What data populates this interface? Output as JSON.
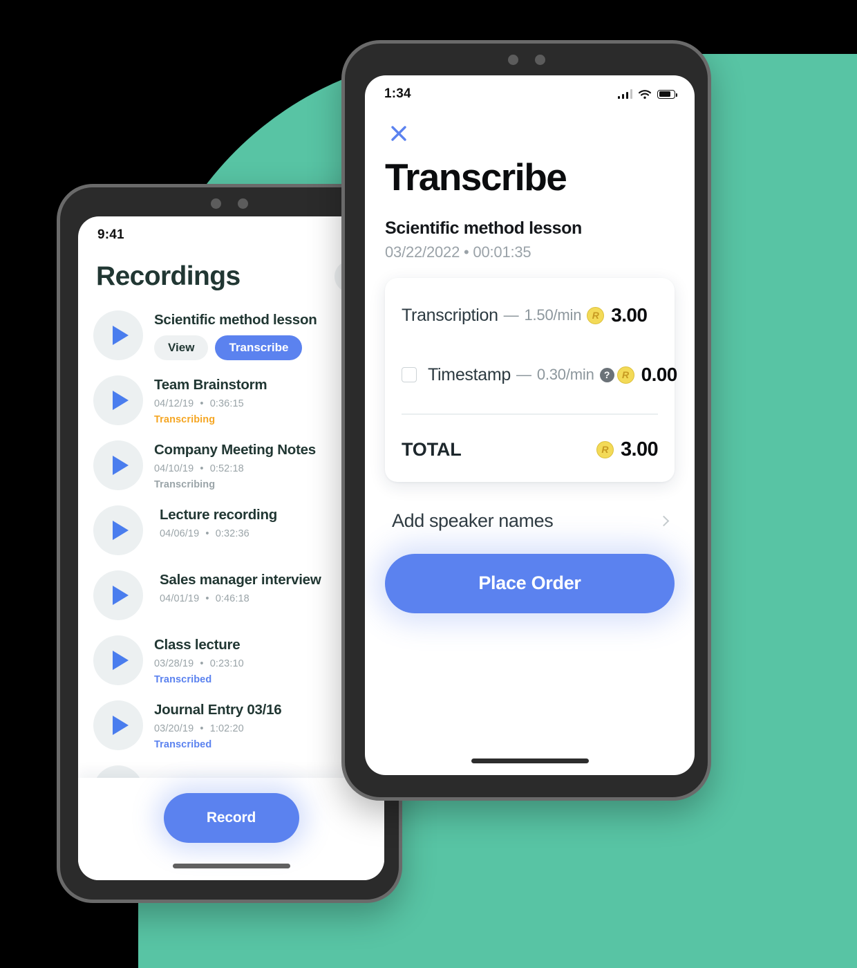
{
  "theme": {
    "accent_blue": "#5b82ef",
    "backdrop_green": "#58C4A4",
    "heading_dark": "#213733",
    "coin_yellow": "#f3da57",
    "status_transcribing": "#f5a623",
    "status_transcribed": "#5b82ef",
    "muted_gray": "#9aa4a8"
  },
  "recordings_phone": {
    "status_bar": {
      "time": "9:41",
      "signal_icon": "cellular-signal-icon"
    },
    "header": {
      "title": "Recordings",
      "search_icon": "search-icon"
    },
    "items": [
      {
        "name": "Scientific method lesson",
        "play_icon": "play-icon",
        "actions": [
          {
            "label": "View",
            "style": "secondary"
          },
          {
            "label": "Transcribe",
            "style": "primary"
          }
        ]
      },
      {
        "name": "Team Brainstorm",
        "play_icon": "play-icon",
        "date": "04/12/19",
        "separator": "•",
        "duration": "0:36:15",
        "status": "Transcribing",
        "status_style": "transcribing-active"
      },
      {
        "name": "Company Meeting Notes",
        "play_icon": "play-icon",
        "date": "04/10/19",
        "separator": "•",
        "duration": "0:52:18",
        "status": "Transcribing",
        "status_style": "transcribing-idle"
      },
      {
        "name": "Lecture recording",
        "play_icon": "play-icon",
        "date": "04/06/19",
        "separator": "•",
        "duration": "0:32:36",
        "status": "",
        "status_style": "none"
      },
      {
        "name": "Sales manager interview",
        "play_icon": "play-icon",
        "date": "04/01/19",
        "separator": "•",
        "duration": "0:46:18",
        "status": "",
        "status_style": "none"
      },
      {
        "name": "Class lecture",
        "play_icon": "play-icon",
        "date": "03/28/19",
        "separator": "•",
        "duration": "0:23:10",
        "status": "Transcribed",
        "status_style": "transcribed"
      },
      {
        "name": "Journal Entry 03/16",
        "play_icon": "play-icon",
        "date": "03/20/19",
        "separator": "•",
        "duration": "1:02:20",
        "status": "Transcribed",
        "status_style": "transcribed"
      }
    ],
    "record_button": {
      "label": "Record"
    }
  },
  "transcribe_phone": {
    "status_bar": {
      "time": "1:34",
      "signal_icon": "cellular-signal-icon",
      "wifi_icon": "wifi-icon",
      "battery_icon": "battery-icon"
    },
    "close_icon": "close-icon",
    "title": "Transcribe",
    "recording_name": "Scientific method lesson",
    "recording_meta": "03/22/2022 • 00:01:35",
    "price_card": {
      "rows": [
        {
          "has_checkbox": false,
          "checked": false,
          "label": "Transcription",
          "dash": "—",
          "rate": "1.50/min",
          "has_help": false,
          "help_glyph": "?",
          "coin_glyph": "R",
          "amount": "3.00"
        },
        {
          "has_checkbox": true,
          "checked": false,
          "label": "Timestamp",
          "dash": "—",
          "rate": "0.30/min",
          "has_help": true,
          "help_glyph": "?",
          "coin_glyph": "R",
          "amount": "0.00"
        }
      ],
      "total_label": "TOTAL",
      "total_coin_glyph": "R",
      "total_amount": "3.00"
    },
    "speaker_names": {
      "label": "Add speaker names",
      "chevron_icon": "chevron-right-icon"
    },
    "order_button": {
      "label": "Place Order"
    }
  }
}
